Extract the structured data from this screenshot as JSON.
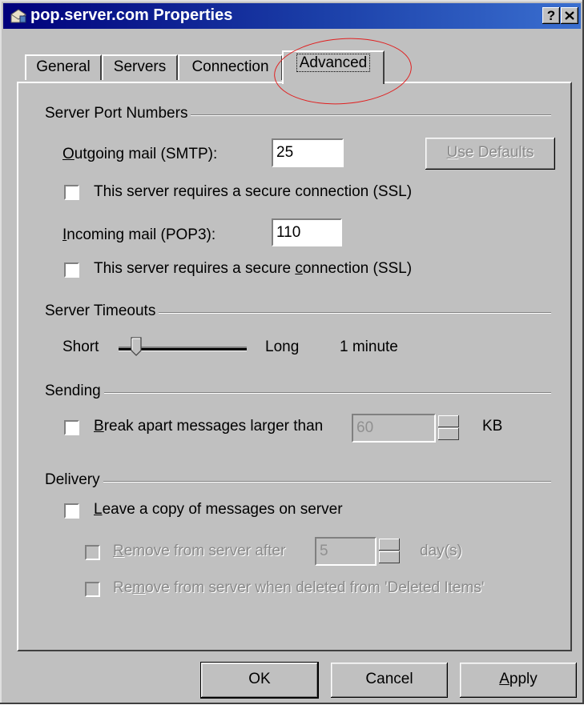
{
  "window": {
    "title": "pop.server.com Properties",
    "help_label": "?"
  },
  "tabs": [
    {
      "label": "General"
    },
    {
      "label": "Servers"
    },
    {
      "label": "Connection"
    },
    {
      "label": "Advanced"
    }
  ],
  "server_ports": {
    "group_label": "Server Port Numbers",
    "outgoing_label_prefix": "",
    "outgoing_mnemonic": "O",
    "outgoing_label_rest": "utgoing mail (SMTP):",
    "outgoing_value": "25",
    "use_defaults_mnemonic": "U",
    "use_defaults_rest": "se Defaults",
    "ssl_outgoing": "This server requires a secure connection (SSL)",
    "incoming_mnemonic": "I",
    "incoming_label_rest": "ncoming mail (POP3):",
    "incoming_value": "110",
    "ssl_incoming_pre": "This server requires a secure ",
    "ssl_incoming_mnemonic": "c",
    "ssl_incoming_post": "onnection (SSL)"
  },
  "timeouts": {
    "group_label": "Server Timeouts",
    "short_label": "Short",
    "long_label": "Long",
    "value_text": "1 minute",
    "slider_level": 0.1
  },
  "sending": {
    "group_label": "Sending",
    "break_mnemonic": "B",
    "break_rest": "reak apart messages larger than",
    "size_value": "60",
    "unit": "KB"
  },
  "delivery": {
    "group_label": "Delivery",
    "leave_mnemonic": "L",
    "leave_rest": "eave a copy of messages on server",
    "remove_after_mnemonic": "R",
    "remove_after_rest": "emove from server after",
    "days_value": "5",
    "days_unit": "day(s)",
    "remove_deleted_pre": "Re",
    "remove_deleted_mnemonic": "m",
    "remove_deleted_post": "ove from server when deleted from 'Deleted Items'"
  },
  "buttons": {
    "ok": "OK",
    "cancel": "Cancel",
    "apply_mnemonic": "A",
    "apply_rest": "pply"
  },
  "colors": {
    "titlebar": "#00007b",
    "face": "#c0c0c0",
    "annotation_circle": "#e02020"
  }
}
